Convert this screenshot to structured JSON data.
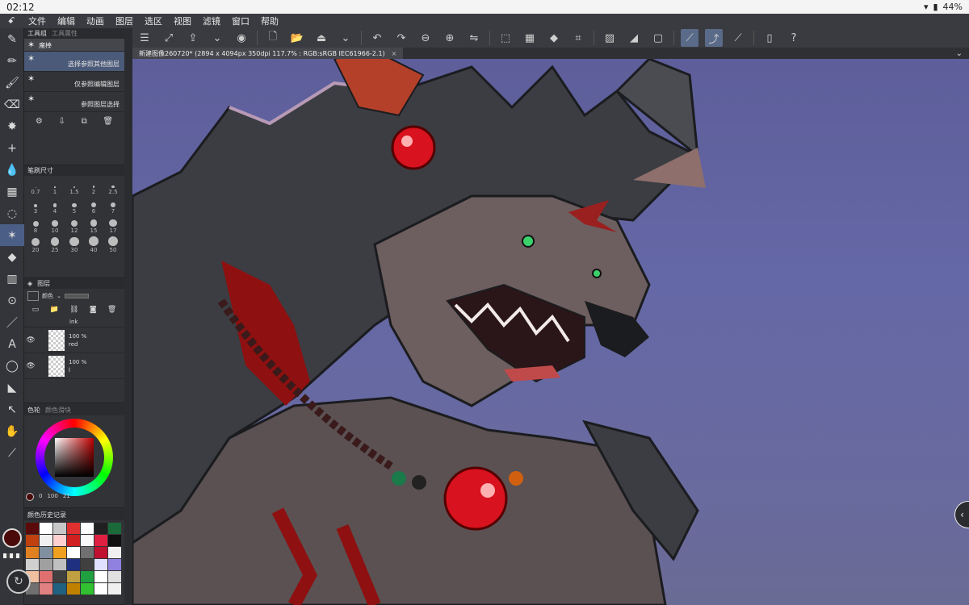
{
  "statusbar": {
    "time": "02:12",
    "battery": "44%",
    "icons": [
      "wifi-icon",
      "battery-icon"
    ]
  },
  "menubar": {
    "items": [
      "文件",
      "编辑",
      "动画",
      "图层",
      "选区",
      "视图",
      "滤镜",
      "窗口",
      "帮助"
    ]
  },
  "document_tab": {
    "title": "新建图像260720* (2894 x 4094px 350dpi 117.7% : RGB:sRGB IEC61966-2.1)",
    "close": "×"
  },
  "tool_property": {
    "tab_subtool": "工具组",
    "tab_property": "工具属性",
    "group_name": "魔棒",
    "subtools": [
      "选择参照其他图层",
      "仅参照编辑图层",
      "参照图层选择"
    ]
  },
  "brush_size": {
    "title": "笔刷尺寸",
    "sizes": [
      "0.7",
      "1",
      "1.5",
      "2",
      "2.5",
      "3",
      "4",
      "5",
      "6",
      "7",
      "8",
      "10",
      "12",
      "15",
      "17",
      "20",
      "25",
      "30",
      "40",
      "50"
    ]
  },
  "layers": {
    "title": "图层",
    "blend_label": "颜色",
    "items": [
      {
        "opacity": "",
        "name": "ink"
      },
      {
        "opacity": "100 %",
        "name": "red"
      },
      {
        "opacity": "100 %",
        "name": "l"
      }
    ]
  },
  "color_wheel": {
    "tab_wheel": "色轮",
    "tab_slider": "颜色滑块",
    "values": [
      "0",
      "100",
      "21"
    ]
  },
  "color_history": {
    "title": "颜色历史记录",
    "colors": [
      "#5a0a0a",
      "#ffffff",
      "#c8c8c8",
      "#e03030",
      "#ffffff",
      "#202020",
      "#1a6a3a",
      "#c04010",
      "#f0f0f0",
      "#ffd0d0",
      "#d02020",
      "#f8f8f8",
      "#e02040",
      "#101010",
      "#e08020",
      "#8090a0",
      "#f0a020",
      "#ffffff",
      "#707070",
      "#c01030",
      "#f0f0f0",
      "#d0d0d0",
      "#a0a0a0",
      "#c0c0c0",
      "#203080",
      "#404040",
      "#e0e0ff",
      "#9080e0",
      "#f0c0a0",
      "#e07070",
      "#404040",
      "#c0a040",
      "#20a040",
      "#ffffff",
      "#e0e0e0",
      "#707070",
      "#e08080",
      "#206080",
      "#c08000",
      "#30c030",
      "#ffffff",
      "#f0f0f0"
    ]
  }
}
